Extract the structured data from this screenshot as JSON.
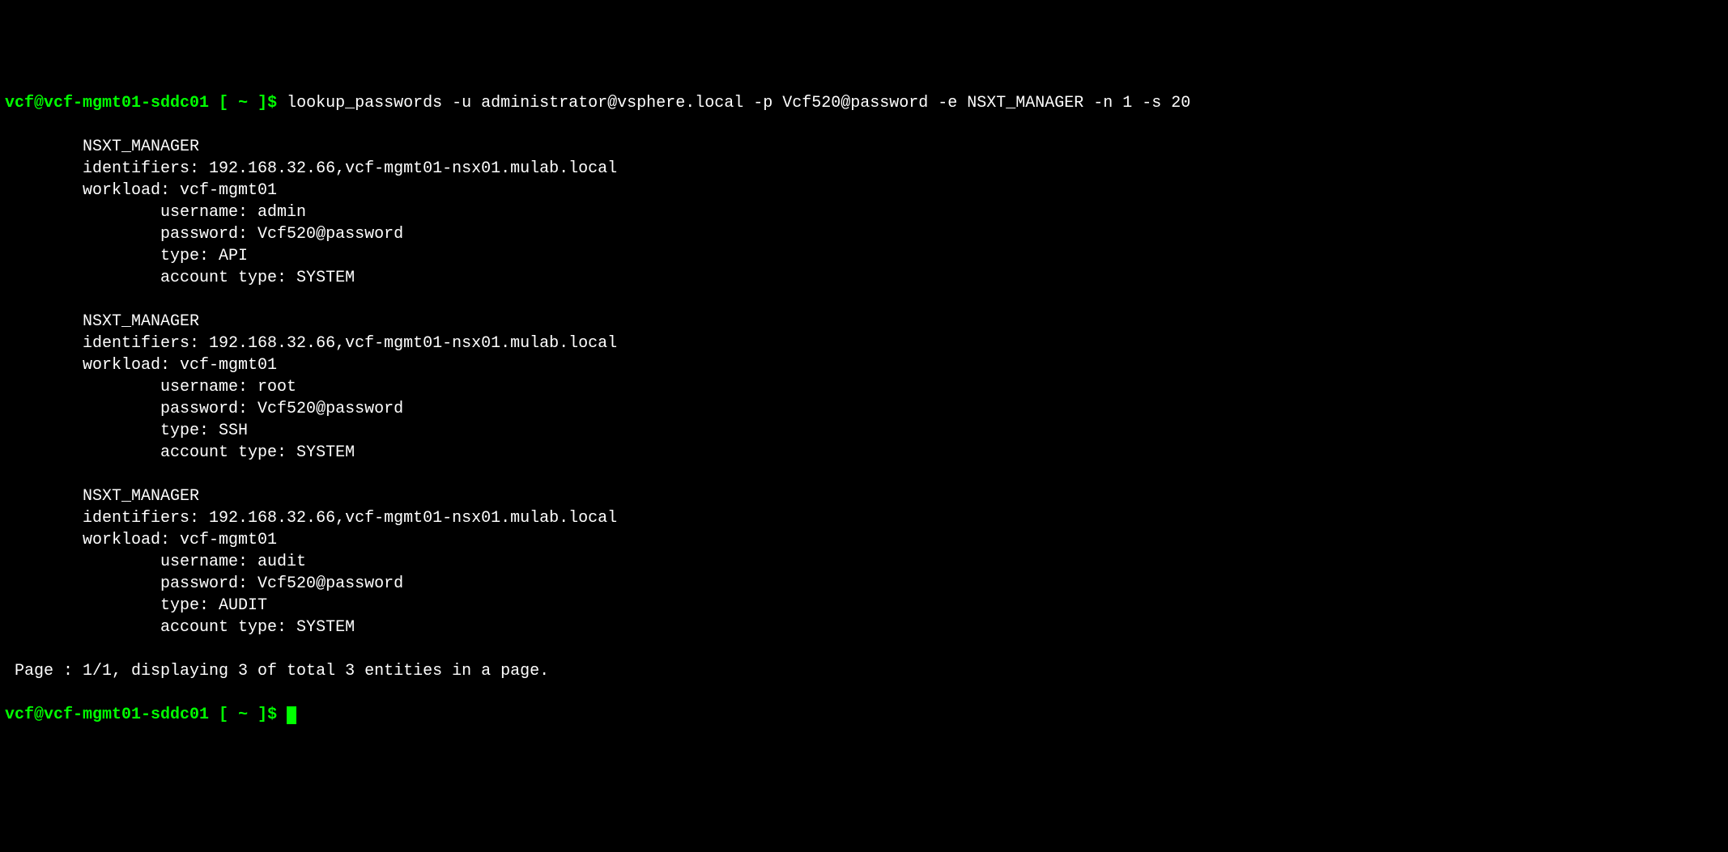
{
  "prompt1": {
    "user": "vcf@vcf-mgmt01-sddc01",
    "open": " [ ",
    "path": "~",
    "close": " ]",
    "dollar": "$ "
  },
  "command": "lookup_passwords -u administrator@vsphere.local -p Vcf520@password -e NSXT_MANAGER -n 1 -s 20",
  "blocks": [
    {
      "title": "NSXT_MANAGER",
      "identifiers": "identifiers: 192.168.32.66,vcf-mgmt01-nsx01.mulab.local",
      "workload": "workload: vcf-mgmt01",
      "username": "username: admin",
      "password": "password: Vcf520@password",
      "type": "type: API",
      "account_type": "account type: SYSTEM"
    },
    {
      "title": "NSXT_MANAGER",
      "identifiers": "identifiers: 192.168.32.66,vcf-mgmt01-nsx01.mulab.local",
      "workload": "workload: vcf-mgmt01",
      "username": "username: root",
      "password": "password: Vcf520@password",
      "type": "type: SSH",
      "account_type": "account type: SYSTEM"
    },
    {
      "title": "NSXT_MANAGER",
      "identifiers": "identifiers: 192.168.32.66,vcf-mgmt01-nsx01.mulab.local",
      "workload": "workload: vcf-mgmt01",
      "username": "username: audit",
      "password": "password: Vcf520@password",
      "type": "type: AUDIT",
      "account_type": "account type: SYSTEM"
    }
  ],
  "page_summary": " Page : 1/1, displaying 3 of total 3 entities in a page.",
  "prompt2": {
    "user": "vcf@vcf-mgmt01-sddc01",
    "open": " [ ",
    "path": "~",
    "close": " ]",
    "dollar": "$ "
  }
}
